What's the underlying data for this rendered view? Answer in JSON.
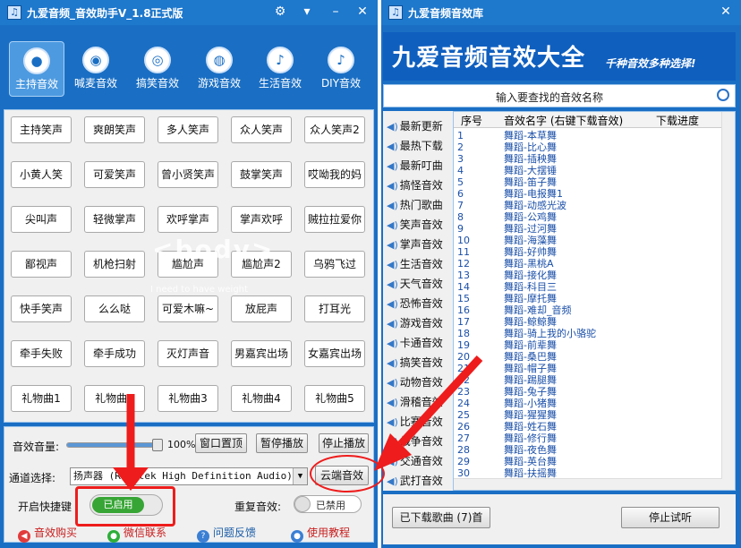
{
  "left_window": {
    "title": "九爱音频_音效助手V_1.8正式版",
    "title_icons": [
      "gear-icon",
      "shirt-icon"
    ],
    "window_controls": [
      "minimize-icon",
      "close-icon"
    ],
    "modes": [
      {
        "label": "主持音效",
        "icon": "person-icon",
        "active": true
      },
      {
        "label": "喊麦音效",
        "icon": "disc-icon",
        "active": false
      },
      {
        "label": "搞笑音效",
        "icon": "gamepad-icon",
        "active": false
      },
      {
        "label": "游戏音效",
        "icon": "controller-icon",
        "active": false
      },
      {
        "label": "生活音效",
        "icon": "bell-icon",
        "active": false
      },
      {
        "label": "DIY音效",
        "icon": "bell-icon",
        "active": false
      }
    ],
    "sound_buttons": [
      [
        "主持笑声",
        "爽朗笑声",
        "多人笑声",
        "众人笑声",
        "众人笑声2"
      ],
      [
        "小黄人笑",
        "可爱笑声",
        "曾小贤笑声",
        "鼓掌笑声",
        "哎呦我的妈"
      ],
      [
        "尖叫声",
        "轻微掌声",
        "欢呼掌声",
        "掌声欢呼",
        "贼拉拉爱你"
      ],
      [
        "鄙视声",
        "机枪扫射",
        "尴尬声",
        "尴尬声2",
        "乌鸦飞过"
      ],
      [
        "快手笑声",
        "么么哒",
        "可爱木嘛~",
        "放屁声",
        "打耳光"
      ],
      [
        "牵手失败",
        "牵手成功",
        "灭灯声音",
        "男嘉宾出场",
        "女嘉宾出场"
      ],
      [
        "礼物曲1",
        "礼物曲2",
        "礼物曲3",
        "礼物曲4",
        "礼物曲5"
      ]
    ],
    "watermark": "<body>",
    "watermark_sub": "I need to have weight",
    "volume_label": "音效音量:",
    "volume_percent": "100%",
    "volume_value": 100,
    "btn_window_top": "窗口置顶",
    "btn_pause": "暂停播放",
    "btn_stop": "停止播放",
    "channel_label": "通道选择:",
    "channel_value": "扬声器 (Realtek High Definition Audio)",
    "btn_cloud": "云端音效",
    "hotkey_label": "开启快捷键",
    "hotkey_state": "已启用",
    "repeat_label": "重复音效:",
    "repeat_state": "已禁用",
    "links": [
      {
        "label": "音效购买",
        "icon": "speaker-icon",
        "color": "red"
      },
      {
        "label": "微信联系",
        "icon": "wechat-icon",
        "color": "red"
      },
      {
        "label": "问题反馈",
        "icon": "question-icon",
        "color": "blue"
      },
      {
        "label": "使用教程",
        "icon": "user-icon",
        "color": "red"
      }
    ]
  },
  "right_window": {
    "title": "九爱音频音效库",
    "banner_title": "九爱音频音效大全",
    "banner_slogan": "千种音效多种选择!",
    "search_placeholder": "输入要查找的音效名称",
    "categories": [
      "最新更新",
      "最热下载",
      "最新叮曲",
      "搞怪音效",
      "热门歌曲",
      "笑声音效",
      "掌声音效",
      "生活音效",
      "天气音效",
      "恐怖音效",
      "游戏音效",
      "卡通音效",
      "搞笑音效",
      "动物音效",
      "滑稽音效",
      "比赛音效",
      "战争音效",
      "交通音效",
      "武打音效"
    ],
    "columns": [
      "序号",
      "音效名字 (右键下载音效)",
      "下载进度"
    ],
    "rows": [
      [
        "1",
        "舞蹈-本草舞"
      ],
      [
        "2",
        "舞蹈-比心舞"
      ],
      [
        "3",
        "舞蹈-插秧舞"
      ],
      [
        "4",
        "舞蹈-大摆锤"
      ],
      [
        "5",
        "舞蹈-笛子舞"
      ],
      [
        "6",
        "舞蹈-电报舞1"
      ],
      [
        "7",
        "舞蹈-动感光波"
      ],
      [
        "8",
        "舞蹈-公鸡舞"
      ],
      [
        "9",
        "舞蹈-过河舞"
      ],
      [
        "10",
        "舞蹈-海藻舞"
      ],
      [
        "11",
        "舞蹈-好帅舞"
      ],
      [
        "12",
        "舞蹈-黑桃A"
      ],
      [
        "13",
        "舞蹈-接化舞"
      ],
      [
        "14",
        "舞蹈-科目三"
      ],
      [
        "15",
        "舞蹈-摩托舞"
      ],
      [
        "16",
        "舞蹈-难却_音频"
      ],
      [
        "17",
        "舞蹈-鲸鲸舞"
      ],
      [
        "18",
        "舞蹈-骑上我的小骆驼"
      ],
      [
        "19",
        "舞蹈-前辈舞"
      ],
      [
        "20",
        "舞蹈-桑巴舞"
      ],
      [
        "21",
        "舞蹈-帽子舞"
      ],
      [
        "22",
        "舞蹈-踢腿舞"
      ],
      [
        "23",
        "舞蹈-兔子舞"
      ],
      [
        "24",
        "舞蹈-小猪舞"
      ],
      [
        "25",
        "舞蹈-猩猩舞"
      ],
      [
        "26",
        "舞蹈-姓石舞"
      ],
      [
        "27",
        "舞蹈-修行舞"
      ],
      [
        "28",
        "舞蹈-夜色舞"
      ],
      [
        "29",
        "舞蹈-英台舞"
      ],
      [
        "30",
        "舞蹈-扶摇舞"
      ]
    ],
    "btn_downloaded": "已下载歌曲 (7)首",
    "btn_stop_trial": "停止试听"
  },
  "colors": {
    "window_blue": "#1a6fc4",
    "accent_red": "#ee1c1c",
    "toggle_green": "#37a535",
    "link_blue": "#1a4fa8"
  }
}
